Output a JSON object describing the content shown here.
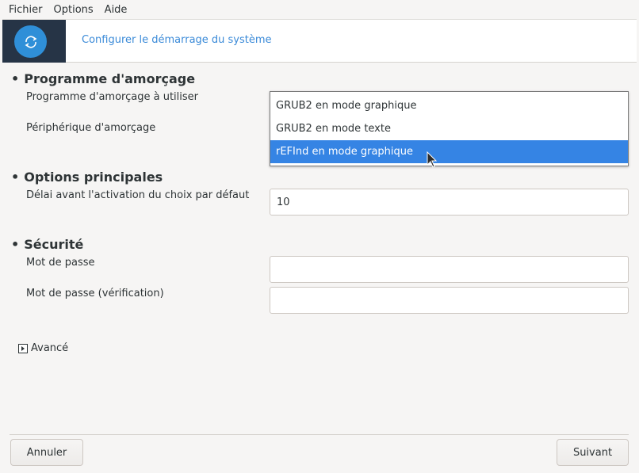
{
  "menubar": {
    "items": [
      {
        "label": "Fichier"
      },
      {
        "label": "Options"
      },
      {
        "label": "Aide"
      }
    ]
  },
  "banner": {
    "title": "Configurer le démarrage du système",
    "icon": "refresh-cycle-icon",
    "accent_color": "#3a8ad8",
    "logo_bg": "#263446"
  },
  "sections": {
    "bootloader": {
      "heading": "Programme d'amorçage",
      "bootloader_label": "Programme d'amorçage à utiliser",
      "device_label": "Périphérique d'amorçage",
      "dropdown_options": [
        {
          "label": "GRUB2 en mode graphique"
        },
        {
          "label": "GRUB2 en mode texte"
        },
        {
          "label": "rEFInd en mode graphique",
          "highlighted": true
        }
      ]
    },
    "main_options": {
      "heading": "Options principales",
      "delay_label": "Délai avant l'activation du choix par défaut",
      "delay_value": "10"
    },
    "security": {
      "heading": "Sécurité",
      "password_label": "Mot de passe",
      "password_value": "",
      "password_verify_label": "Mot de passe (vérification)",
      "password_verify_value": ""
    }
  },
  "advanced": {
    "label": "Avancé",
    "expanded": false
  },
  "footer": {
    "cancel_label": "Annuler",
    "next_label": "Suivant"
  },
  "colors": {
    "selection": "#3584e4",
    "background": "#f6f5f4"
  }
}
